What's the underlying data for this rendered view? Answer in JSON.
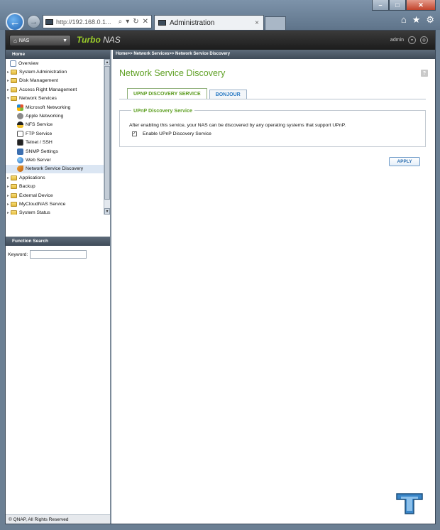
{
  "browser": {
    "address_url": "http://192.168.0.1...",
    "tab_title": "Administration",
    "tab_close": "×",
    "back_glyph": "←",
    "forward_glyph": "→",
    "address_controls": [
      "⌕",
      "▾",
      "↻",
      "✕"
    ],
    "toolbar_icons": [
      "home-icon",
      "favorites-star-icon",
      "settings-gear-icon"
    ],
    "toolbar_glyphs": [
      "⌂",
      "★",
      "⚙"
    ],
    "window_controls": [
      "–",
      "□",
      "✕"
    ]
  },
  "header": {
    "nas_menu_label": "NAS",
    "brand_turbo": "Turbo",
    "brand_nas": "NAS",
    "user": "admin"
  },
  "sidebar": {
    "title": "Home",
    "items": [
      {
        "label": "Overview",
        "level": 1,
        "icon": "overview-icon"
      },
      {
        "label": "System Administration",
        "level": 0,
        "icon": "folder-icon",
        "toggle": "▸"
      },
      {
        "label": "Disk Management",
        "level": 0,
        "icon": "folder-icon",
        "toggle": "▸"
      },
      {
        "label": "Access Right Management",
        "level": 0,
        "icon": "folder-icon",
        "toggle": "▸"
      },
      {
        "label": "Network Services",
        "level": 0,
        "icon": "folder-open-icon",
        "toggle": "▾"
      },
      {
        "label": "Microsoft Networking",
        "level": 1,
        "icon": "windows-icon"
      },
      {
        "label": "Apple Networking",
        "level": 1,
        "icon": "apple-icon"
      },
      {
        "label": "NFS Service",
        "level": 1,
        "icon": "linux-penguin-icon"
      },
      {
        "label": "FTP Service",
        "level": 1,
        "icon": "ftp-icon"
      },
      {
        "label": "Telnet / SSH",
        "level": 1,
        "icon": "terminal-icon"
      },
      {
        "label": "SNMP Settings",
        "level": 1,
        "icon": "snmp-icon"
      },
      {
        "label": "Web Server",
        "level": 1,
        "icon": "globe-icon"
      },
      {
        "label": "Network Service Discovery",
        "level": 1,
        "icon": "discovery-icon",
        "selected": true
      },
      {
        "label": "Applications",
        "level": 0,
        "icon": "folder-icon",
        "toggle": "▸"
      },
      {
        "label": "Backup",
        "level": 0,
        "icon": "folder-icon",
        "toggle": "▸"
      },
      {
        "label": "External Device",
        "level": 0,
        "icon": "folder-icon",
        "toggle": "▸"
      },
      {
        "label": "MyCloudNAS Service",
        "level": 0,
        "icon": "folder-icon",
        "toggle": "▸"
      },
      {
        "label": "System Status",
        "level": 0,
        "icon": "folder-icon",
        "toggle": "▸"
      }
    ],
    "function_search_title": "Function Search",
    "keyword_label": "Keyword:",
    "keyword_value": "",
    "copyright": "© QNAP, All Rights Reserved"
  },
  "main": {
    "breadcrumb": "Home>> Network Services>> Network Service Discovery",
    "title": "Network Service Discovery",
    "help_glyph": "?",
    "tabs": [
      {
        "label": "UPNP DISCOVERY SERVICE",
        "active": true
      },
      {
        "label": "BONJOUR",
        "active": false
      }
    ],
    "section_title": "UPnP Discovery Service",
    "description": "After enabling this service, your NAS can be discovered by any operating systems that support UPnP.",
    "enable_label": "Enable UPnP Discovery Service",
    "enable_checked": true,
    "apply_label": "APPLY"
  },
  "colors": {
    "accent_green": "#5fa024",
    "tab_blue": "#2d7cc4",
    "header_dark": "#1c1c1c"
  }
}
